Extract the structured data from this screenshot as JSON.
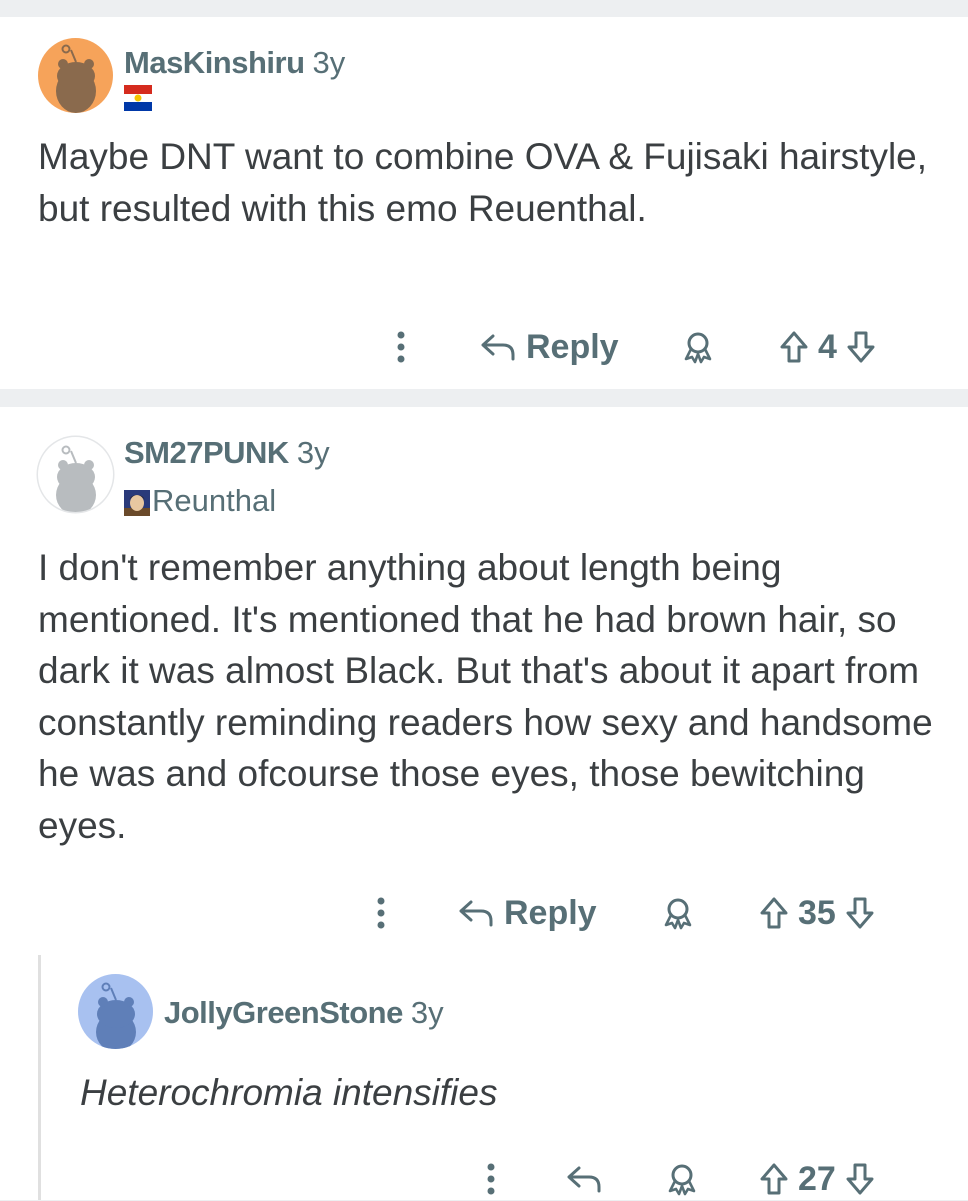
{
  "comments": [
    {
      "username": "MasKinshiru",
      "age": "3y",
      "flair_icon": "flag-icon",
      "body": "Maybe DNT want to combine OVA & Fujisaki hairstyle, but resulted with this emo Reuenthal.",
      "reply_label": "Reply",
      "score": "4",
      "avatar_color": "#f6a35a"
    },
    {
      "username": "SM27PUNK",
      "age": "3y",
      "flair_text": "Reunthal",
      "body": "I don't remember anything about length being mentioned. It's mentioned that he had brown hair, so dark it was almost Black. But that's about it apart from constantly reminding readers how sexy and handsome he was and ofcourse those eyes, those bewitching eyes.",
      "reply_label": "Reply",
      "score": "35",
      "avatar_color": "#ffffff"
    },
    {
      "username": "JollyGreenStone",
      "age": "3y",
      "body": "Heterochromia intensifies",
      "score": "27",
      "avatar_color": "#a8c1f0"
    }
  ],
  "colors": {
    "meta_gray": "#576f76",
    "body_text": "#3b3f42",
    "page_bg": "#edeff1"
  }
}
